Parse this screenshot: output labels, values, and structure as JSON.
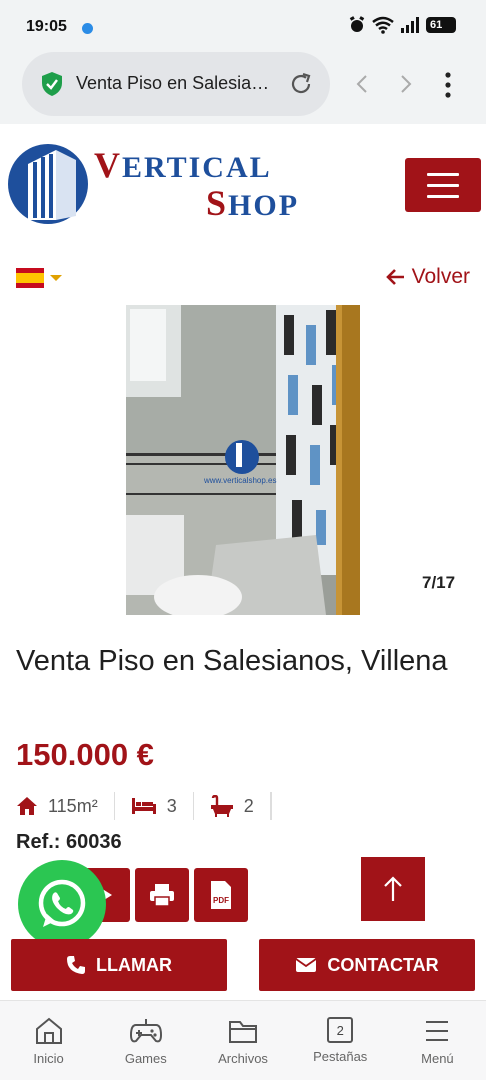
{
  "status_bar": {
    "time": "19:05",
    "battery": "61"
  },
  "browser": {
    "url_title": "Venta Piso en Salesia…"
  },
  "site": {
    "logo_line1": {
      "first": "V",
      "rest": "ERTICAL"
    },
    "logo_line2": {
      "first": "S",
      "rest": "HOP"
    },
    "back_label": "Volver",
    "photo_counter": "7/17",
    "watermark": "www.verticalshop.es"
  },
  "listing": {
    "title": "Venta Piso en Salesianos, Villena",
    "price": "150.000 €",
    "area": "115m²",
    "bedrooms": "3",
    "bathrooms": "2",
    "ref": "Ref.: 60036"
  },
  "actions": {
    "call_label": "LLAMAR",
    "contact_label": "CONTACTAR"
  },
  "bottom_nav": {
    "items": [
      {
        "label": "Inicio"
      },
      {
        "label": "Games"
      },
      {
        "label": "Archivos"
      },
      {
        "label": "Pestañas",
        "badge": "2"
      },
      {
        "label": "Menú"
      }
    ]
  },
  "colors": {
    "brand_red": "#a11318",
    "brand_blue": "#1e4f9c",
    "whatsapp": "#2bc652"
  }
}
